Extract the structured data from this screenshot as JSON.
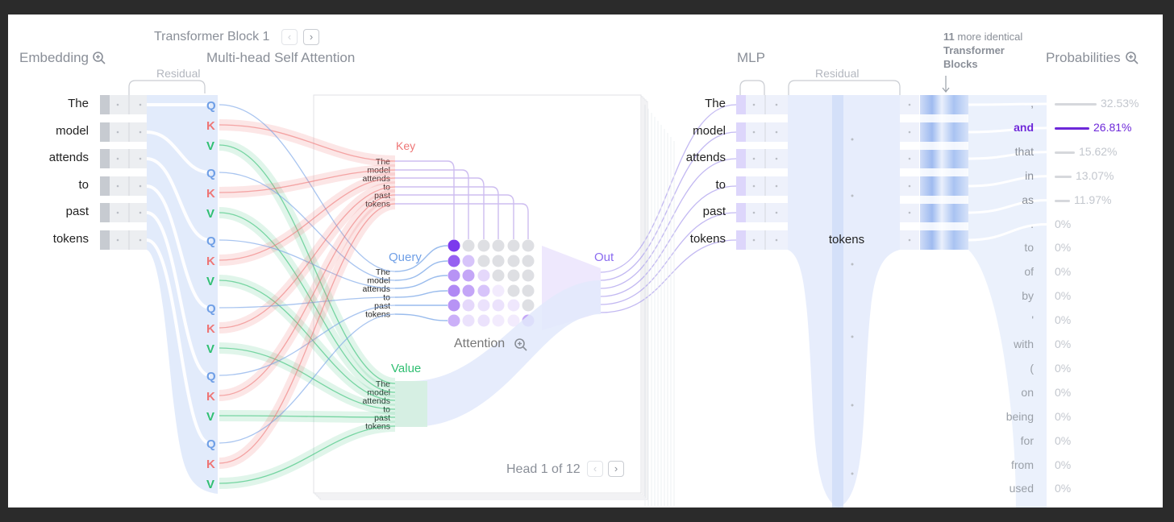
{
  "headers": {
    "embedding": "Embedding",
    "block_title": "Transformer Block 1",
    "attention": "Multi-head Self Attention",
    "mlp": "MLP",
    "probabilities": "Probabilities",
    "residual": "Residual",
    "more_blocks_count": "11",
    "more_blocks_text": "more identical",
    "more_blocks_bold": "Transformer Blocks"
  },
  "tokens": [
    "The",
    "model",
    "attends",
    "to",
    "past",
    "tokens"
  ],
  "qkv": {
    "q": "Q",
    "k": "K",
    "v": "V"
  },
  "attention_panel": {
    "key": "Key",
    "query": "Query",
    "value": "Value",
    "out": "Out",
    "attention": "Attention",
    "head": "Head 1 of 12"
  },
  "attention_matrix": [
    [
      1.0,
      0,
      0,
      0,
      0,
      0
    ],
    [
      0.8,
      0.3,
      0,
      0,
      0,
      0
    ],
    [
      0.55,
      0.45,
      0.2,
      0,
      0,
      0
    ],
    [
      0.6,
      0.45,
      0.3,
      0.08,
      0,
      0
    ],
    [
      0.55,
      0.2,
      0.15,
      0.15,
      0.12,
      0
    ],
    [
      0.4,
      0.15,
      0.15,
      0.1,
      0.05,
      0.45
    ]
  ],
  "mlp_token": "tokens",
  "probabilities": [
    {
      "token": ",",
      "value": "32.53%",
      "p": 0.3253
    },
    {
      "token": "and",
      "value": "26.81%",
      "p": 0.2681,
      "highlight": true
    },
    {
      "token": "that",
      "value": "15.62%",
      "p": 0.1562
    },
    {
      "token": "in",
      "value": "13.07%",
      "p": 0.1307
    },
    {
      "token": "as",
      "value": "11.97%",
      "p": 0.1197
    },
    {
      "token": ".",
      "value": "0%",
      "p": 0
    },
    {
      "token": "to",
      "value": "0%",
      "p": 0
    },
    {
      "token": "of",
      "value": "0%",
      "p": 0
    },
    {
      "token": "by",
      "value": "0%",
      "p": 0
    },
    {
      "token": "'",
      "value": "0%",
      "p": 0
    },
    {
      "token": "with",
      "value": "0%",
      "p": 0
    },
    {
      "token": "(",
      "value": "0%",
      "p": 0
    },
    {
      "token": "on",
      "value": "0%",
      "p": 0
    },
    {
      "token": "being",
      "value": "0%",
      "p": 0
    },
    {
      "token": "for",
      "value": "0%",
      "p": 0
    },
    {
      "token": "from",
      "value": "0%",
      "p": 0
    },
    {
      "token": "used",
      "value": "0%",
      "p": 0
    }
  ],
  "colors": {
    "query": "#6f9fe6",
    "key": "#ee7676",
    "value": "#2fbf71",
    "attn": "#7c3aed",
    "highlight": "#6d28d9"
  }
}
